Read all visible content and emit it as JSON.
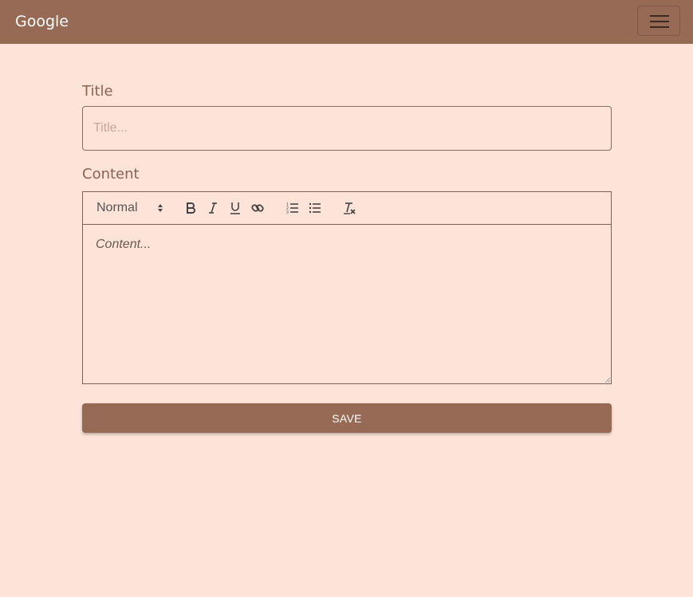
{
  "navbar": {
    "brand": "Google",
    "toggle_icon": "hamburger-menu-icon",
    "bg_color": "#966a55"
  },
  "form": {
    "title_label": "Title",
    "title_placeholder": "Title...",
    "title_value": "",
    "content_label": "Content",
    "content_placeholder": "Content...",
    "toolbar": {
      "header_select": "Normal",
      "buttons": [
        "bold-icon",
        "italic-icon",
        "underline-icon",
        "link-icon",
        "ordered-list-icon",
        "bullet-list-icon",
        "clear-format-icon"
      ]
    },
    "save_label": "SAVE"
  },
  "colors": {
    "page_bg": "#fee3d8",
    "accent": "#966a55"
  }
}
